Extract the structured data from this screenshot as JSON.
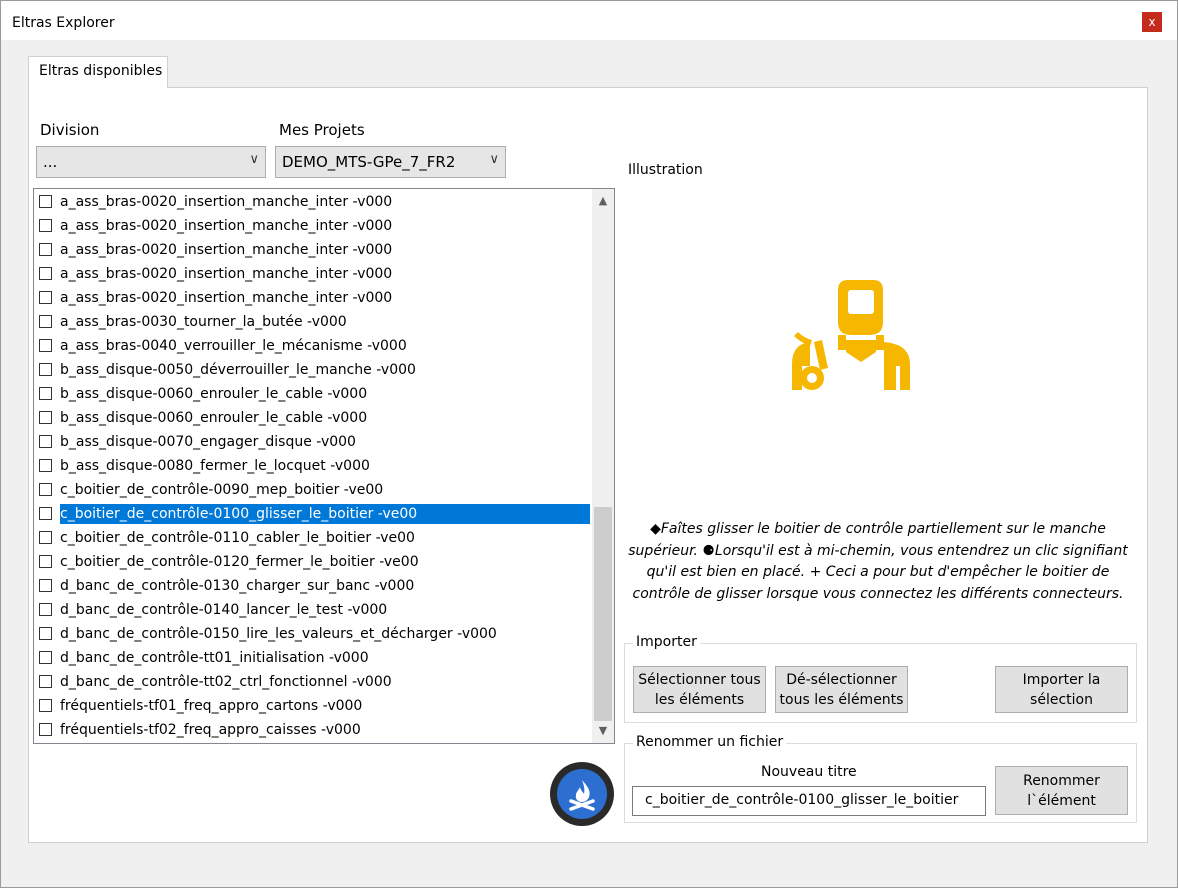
{
  "window": {
    "title": "Eltras Explorer",
    "close_glyph": "x"
  },
  "tab": {
    "label": "Eltras disponibles"
  },
  "division": {
    "label": "Division",
    "value": "..."
  },
  "projects": {
    "label": "Mes Projets",
    "value": "DEMO_MTS-GPe_7_FR2"
  },
  "list": {
    "items": [
      {
        "label": "a_ass_bras-0020_insertion_manche_inter -v000",
        "checked": false,
        "selected": false
      },
      {
        "label": "a_ass_bras-0020_insertion_manche_inter -v000",
        "checked": false,
        "selected": false
      },
      {
        "label": "a_ass_bras-0020_insertion_manche_inter -v000",
        "checked": false,
        "selected": false
      },
      {
        "label": "a_ass_bras-0020_insertion_manche_inter -v000",
        "checked": false,
        "selected": false
      },
      {
        "label": "a_ass_bras-0020_insertion_manche_inter -v000",
        "checked": false,
        "selected": false
      },
      {
        "label": "a_ass_bras-0030_tourner_la_butée -v000",
        "checked": false,
        "selected": false
      },
      {
        "label": "a_ass_bras-0040_verrouiller_le_mécanisme -v000",
        "checked": false,
        "selected": false
      },
      {
        "label": "b_ass_disque-0050_déverrouiller_le_manche -v000",
        "checked": false,
        "selected": false
      },
      {
        "label": "b_ass_disque-0060_enrouler_le_cable -v000",
        "checked": false,
        "selected": false
      },
      {
        "label": "b_ass_disque-0060_enrouler_le_cable -v000",
        "checked": false,
        "selected": false
      },
      {
        "label": "b_ass_disque-0070_engager_disque -v000",
        "checked": false,
        "selected": false
      },
      {
        "label": "b_ass_disque-0080_fermer_le_locquet -v000",
        "checked": false,
        "selected": false
      },
      {
        "label": "c_boitier_de_contrôle-0090_mep_boitier -ve00",
        "checked": false,
        "selected": false
      },
      {
        "label": "c_boitier_de_contrôle-0100_glisser_le_boitier -ve00",
        "checked": false,
        "selected": true
      },
      {
        "label": "c_boitier_de_contrôle-0110_cabler_le_boitier -ve00",
        "checked": false,
        "selected": false
      },
      {
        "label": "c_boitier_de_contrôle-0120_fermer_le_boitier -ve00",
        "checked": false,
        "selected": false
      },
      {
        "label": "d_banc_de_contrôle-0130_charger_sur_banc -v000",
        "checked": false,
        "selected": false
      },
      {
        "label": "d_banc_de_contrôle-0140_lancer_le_test -v000",
        "checked": false,
        "selected": false
      },
      {
        "label": "d_banc_de_contrôle-0150_lire_les_valeurs_et_décharger -v000",
        "checked": false,
        "selected": false
      },
      {
        "label": "d_banc_de_contrôle-tt01_initialisation -v000",
        "checked": false,
        "selected": false
      },
      {
        "label": "d_banc_de_contrôle-tt02_ctrl_fonctionnel -v000",
        "checked": false,
        "selected": false
      },
      {
        "label": "fréquentiels-tf01_freq_appro_cartons -v000",
        "checked": false,
        "selected": false
      },
      {
        "label": "fréquentiels-tf02_freq_appro_caisses -v000",
        "checked": false,
        "selected": false
      }
    ]
  },
  "illustration": {
    "label": "Illustration",
    "icon": "welder-icon",
    "icon_color": "#f5b700",
    "description": "◆Faîtes glisser le boitier de contrôle partiellement sur le manche supérieur. ⚈Lorsqu'il est à mi-chemin, vous entendrez un clic signifiant qu'il est bien en placé. + Ceci a pour but d'empêcher le boitier de contrôle de glisser lorsque vous connectez les différents connecteurs."
  },
  "import_group": {
    "title": "Importer",
    "select_all": "Sélectionner tous les éléments",
    "deselect_all": "Dé-sélectionner tous les éléments",
    "import_selection": "Importer la sélection"
  },
  "rename_group": {
    "title": "Renommer un fichier",
    "new_title_label": "Nouveau titre",
    "new_title_value": "c_boitier_de_contrôle-0100_glisser_le_boitier",
    "rename_button": "Renommer l`élément"
  },
  "action_button": {
    "icon": "campfire-icon",
    "color": "#2d6fd0"
  }
}
